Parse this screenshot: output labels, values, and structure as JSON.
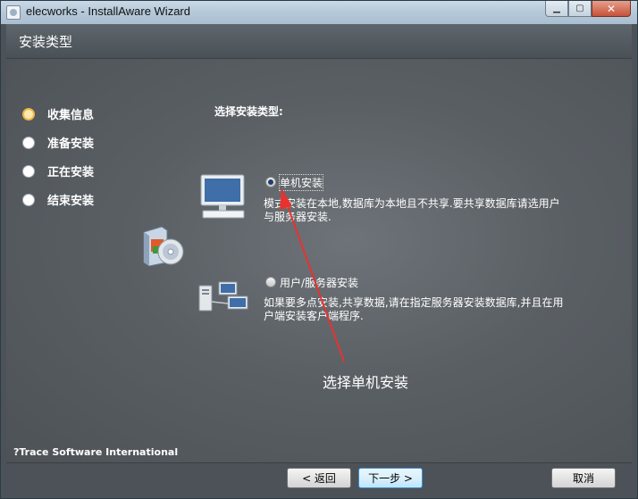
{
  "window": {
    "title": "elecworks - InstallAware Wizard"
  },
  "header": {
    "title": "安装类型"
  },
  "steps": [
    {
      "label": "收集信息",
      "active": true
    },
    {
      "label": "准备安装",
      "active": false
    },
    {
      "label": "正在安装",
      "active": false
    },
    {
      "label": "结束安装",
      "active": false
    }
  ],
  "main": {
    "section_title": "选择安装类型:",
    "options": [
      {
        "label": "单机安装",
        "selected": true,
        "description": "模式安装在本地,数据库为本地且不共享.要共享数据库请选用户与服务器安装."
      },
      {
        "label": "用户/服务器安装",
        "selected": false,
        "description": "如果要多点安装,共享数据,请在指定服务器安装数据库,并且在用户端安装客户端程序."
      }
    ]
  },
  "annotation": {
    "text": "选择单机安装",
    "color": "#e8322e"
  },
  "copyright": "?Trace Software International",
  "buttons": {
    "back": "< 返回",
    "next": "下一步 >",
    "cancel": "取消"
  }
}
